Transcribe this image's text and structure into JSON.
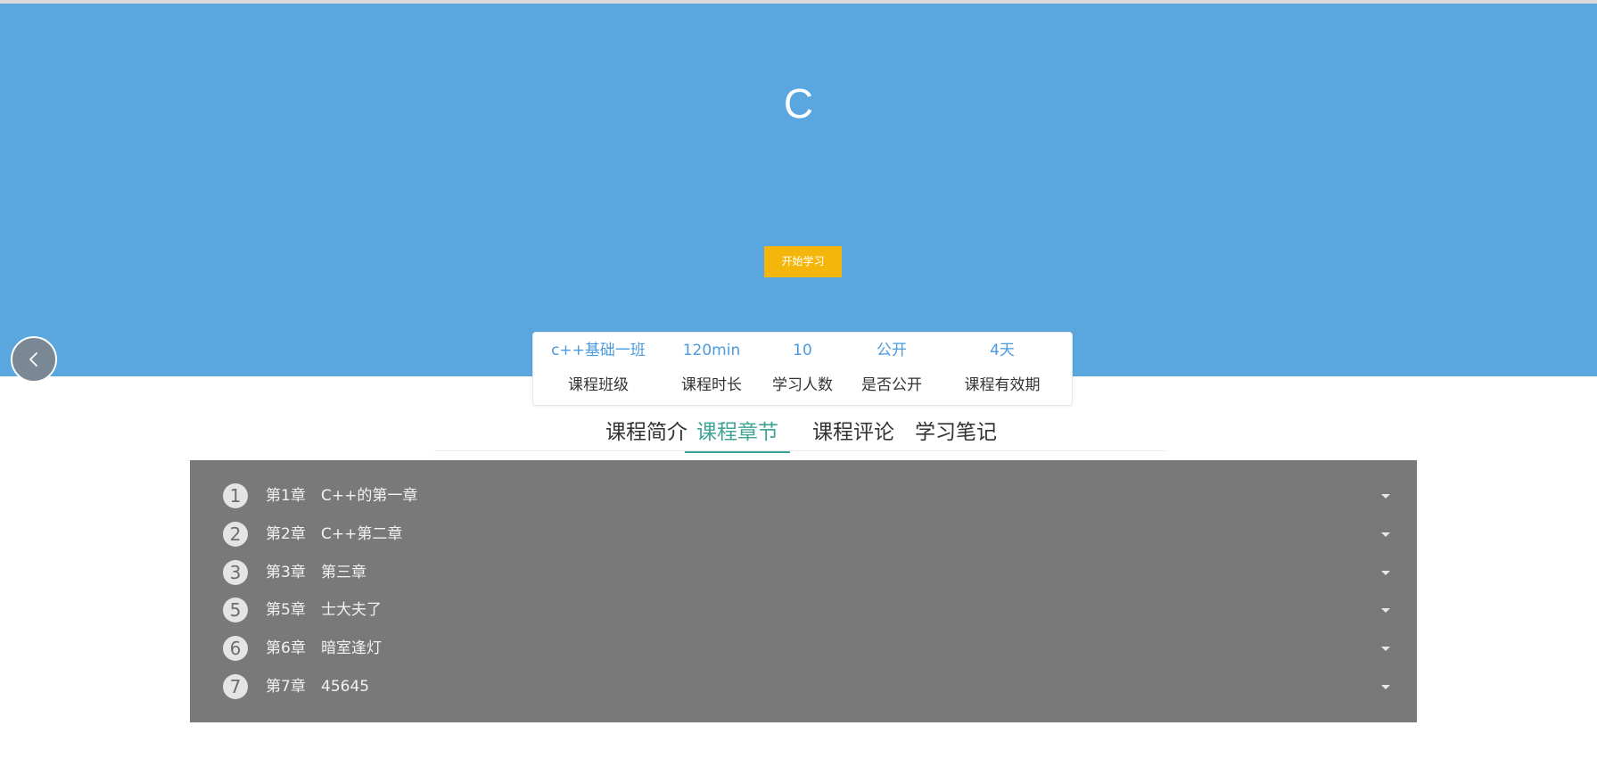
{
  "course": {
    "title": "C",
    "start_button": "开始学习"
  },
  "info": [
    {
      "value": "c++基础一班",
      "label": "课程班级"
    },
    {
      "value": "120min",
      "label": "课程时长"
    },
    {
      "value": "10",
      "label": "学习人数"
    },
    {
      "value": "公开",
      "label": "是否公开"
    },
    {
      "value": "4天",
      "label": "课程有效期"
    }
  ],
  "tabs": [
    {
      "label": "课程简介",
      "active": false
    },
    {
      "label": "课程章节",
      "active": true
    },
    {
      "label": "课程评论",
      "active": false
    },
    {
      "label": "学习笔记",
      "active": false
    }
  ],
  "chapters": [
    {
      "num": "1",
      "chapter": "第1章",
      "name": "C++的第一章"
    },
    {
      "num": "2",
      "chapter": "第2章",
      "name": "C++第二章"
    },
    {
      "num": "3",
      "chapter": "第3章",
      "name": "第三章"
    },
    {
      "num": "5",
      "chapter": "第5章",
      "name": "士大夫了"
    },
    {
      "num": "6",
      "chapter": "第6章",
      "name": "暗室逢灯"
    },
    {
      "num": "7",
      "chapter": "第7章",
      "name": "45645"
    }
  ],
  "colors": {
    "hero": "#5aa6de",
    "start_button": "#f5b60c",
    "accent": "#3fa396",
    "info_value": "#4a9be0",
    "chapter_panel": "#797979"
  },
  "icons": {
    "back": "chevron-left-icon",
    "expand": "caret-down-icon"
  }
}
